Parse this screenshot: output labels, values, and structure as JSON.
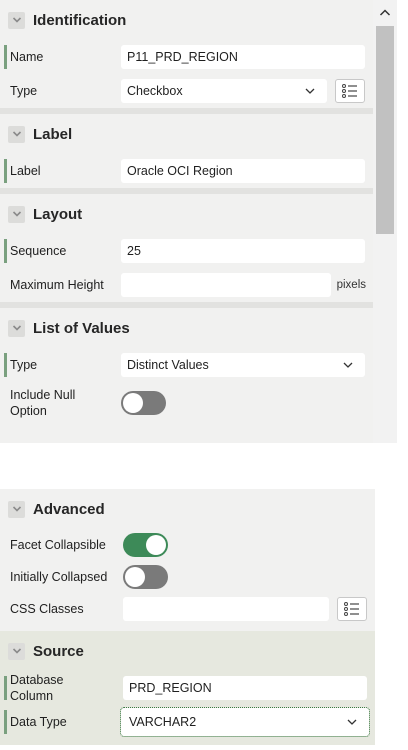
{
  "sections": {
    "identification": {
      "title": "Identification",
      "name_label": "Name",
      "name_value": "P11_PRD_REGION",
      "type_label": "Type",
      "type_value": "Checkbox"
    },
    "label": {
      "title": "Label",
      "label_label": "Label",
      "label_value": "Oracle OCI Region"
    },
    "layout": {
      "title": "Layout",
      "sequence_label": "Sequence",
      "sequence_value": "25",
      "max_height_label": "Maximum Height",
      "max_height_value": "",
      "max_height_unit": "pixels"
    },
    "list_of_values": {
      "title": "List of Values",
      "type_label": "Type",
      "type_value": "Distinct Values",
      "include_null_label": "Include Null Option",
      "include_null_on": false
    },
    "advanced": {
      "title": "Advanced",
      "facet_collapsible_label": "Facet Collapsible",
      "facet_collapsible_on": true,
      "initially_collapsed_label": "Initially Collapsed",
      "initially_collapsed_on": false,
      "css_classes_label": "CSS Classes",
      "css_classes_value": ""
    },
    "source": {
      "title": "Source",
      "database_column_label": "Database Column",
      "database_column_value": "PRD_REGION",
      "data_type_label": "Data Type",
      "data_type_value": "VARCHAR2"
    }
  },
  "colors": {
    "panel_bg": "#f1f1f0",
    "marker": "#7aa07f",
    "toggle_on": "#3d8a58",
    "toggle_off": "#7a7a7a",
    "source_bg": "#e6e8df"
  },
  "icons": {
    "collapse": "chevron-down-icon",
    "select": "chevron-down-icon",
    "lov": "list-icon",
    "scroll_up": "chevron-up-icon"
  }
}
